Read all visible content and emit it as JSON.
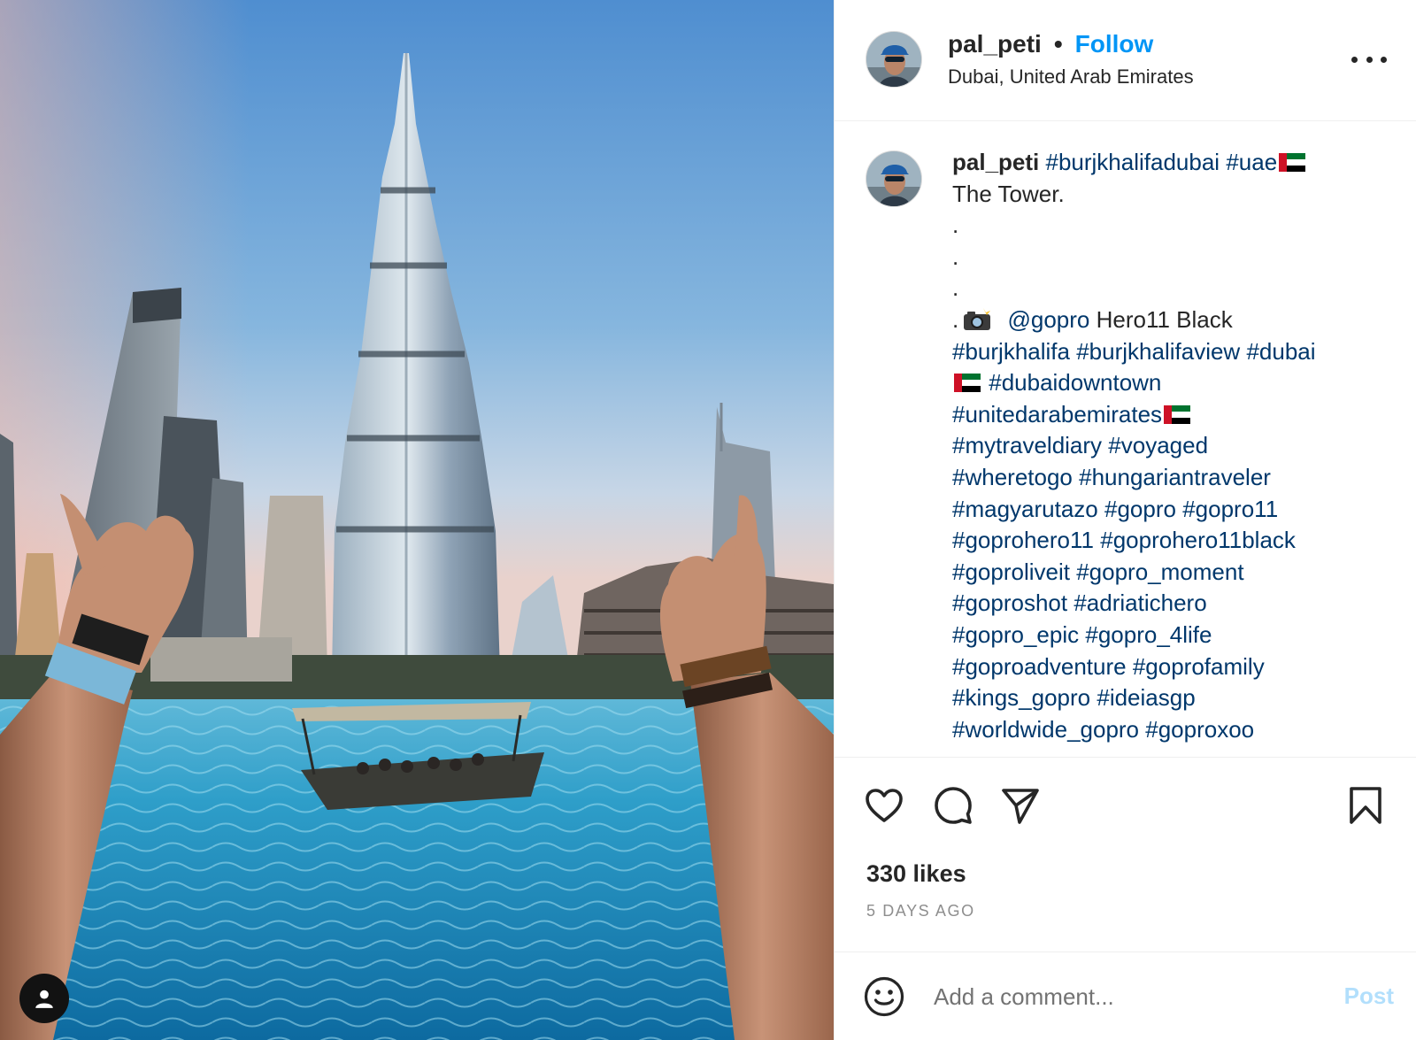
{
  "post": {
    "photo_alt": "",
    "tag_icon": "person-icon"
  },
  "header": {
    "username": "pal_peti",
    "separator": "•",
    "follow_label": "Follow",
    "location": "Dubai, United Arab Emirates",
    "more_icon": "more-options-icon"
  },
  "caption": {
    "username": "pal_peti",
    "lines": [
      [
        "#burjkhalifadubai",
        "#uae"
      ],
      "The Tower.",
      ".",
      ".",
      ".",
      ".",
      [
        "@gopro",
        "Hero11 Black"
      ],
      [
        "#burjkhalifa",
        "#burjkhalifaview",
        "#dubai"
      ],
      [
        "#dubaidowntown"
      ],
      [
        "#unitedarabemirates"
      ],
      [
        "#mytraveldiary",
        "#voyaged"
      ],
      [
        "#wheretogo",
        "#hungariantraveler"
      ],
      [
        "#magyarutazo",
        "#gopro",
        "#gopro11"
      ],
      [
        "#goprohero11",
        "#goprohero11black"
      ],
      [
        "#goproliveit",
        "#gopro_moment"
      ],
      [
        "#goproshot",
        "#adriatichero"
      ],
      [
        "#gopro_epic",
        "#gopro_4life"
      ],
      [
        "#goproadventure",
        "#goprofamily"
      ],
      [
        "#kings_gopro",
        "#ideiasgp"
      ],
      [
        "#worldwide_gopro",
        "#goproxoo"
      ]
    ],
    "emoji": [
      "uae-flag-emoji",
      "camera-with-flash-emoji"
    ]
  },
  "actions": {
    "icons": [
      "heart-icon",
      "comment-icon",
      "share-icon",
      "bookmark-icon"
    ],
    "likes": "330 likes",
    "date": "5 DAYS AGO"
  },
  "comment": {
    "emoji_icon": "smiley-icon",
    "placeholder": "Add a comment...",
    "post_label": "Post"
  },
  "colors": {
    "link_blue": "#0095f6",
    "hashtag": "#00376b",
    "muted": "#8e8e8e",
    "post_disabled": "#b2dffc",
    "text": "#262626"
  }
}
